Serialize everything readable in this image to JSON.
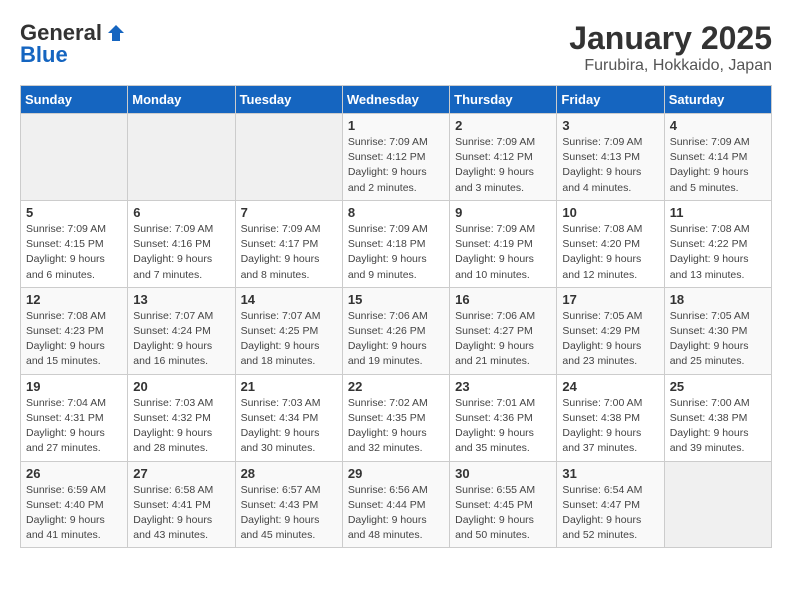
{
  "header": {
    "logo_line1": "General",
    "logo_line2": "Blue",
    "title": "January 2025",
    "subtitle": "Furubira, Hokkaido, Japan"
  },
  "calendar": {
    "days_of_week": [
      "Sunday",
      "Monday",
      "Tuesday",
      "Wednesday",
      "Thursday",
      "Friday",
      "Saturday"
    ],
    "weeks": [
      [
        {
          "day": "",
          "info": ""
        },
        {
          "day": "",
          "info": ""
        },
        {
          "day": "",
          "info": ""
        },
        {
          "day": "1",
          "info": "Sunrise: 7:09 AM\nSunset: 4:12 PM\nDaylight: 9 hours\nand 2 minutes."
        },
        {
          "day": "2",
          "info": "Sunrise: 7:09 AM\nSunset: 4:12 PM\nDaylight: 9 hours\nand 3 minutes."
        },
        {
          "day": "3",
          "info": "Sunrise: 7:09 AM\nSunset: 4:13 PM\nDaylight: 9 hours\nand 4 minutes."
        },
        {
          "day": "4",
          "info": "Sunrise: 7:09 AM\nSunset: 4:14 PM\nDaylight: 9 hours\nand 5 minutes."
        }
      ],
      [
        {
          "day": "5",
          "info": "Sunrise: 7:09 AM\nSunset: 4:15 PM\nDaylight: 9 hours\nand 6 minutes."
        },
        {
          "day": "6",
          "info": "Sunrise: 7:09 AM\nSunset: 4:16 PM\nDaylight: 9 hours\nand 7 minutes."
        },
        {
          "day": "7",
          "info": "Sunrise: 7:09 AM\nSunset: 4:17 PM\nDaylight: 9 hours\nand 8 minutes."
        },
        {
          "day": "8",
          "info": "Sunrise: 7:09 AM\nSunset: 4:18 PM\nDaylight: 9 hours\nand 9 minutes."
        },
        {
          "day": "9",
          "info": "Sunrise: 7:09 AM\nSunset: 4:19 PM\nDaylight: 9 hours\nand 10 minutes."
        },
        {
          "day": "10",
          "info": "Sunrise: 7:08 AM\nSunset: 4:20 PM\nDaylight: 9 hours\nand 12 minutes."
        },
        {
          "day": "11",
          "info": "Sunrise: 7:08 AM\nSunset: 4:22 PM\nDaylight: 9 hours\nand 13 minutes."
        }
      ],
      [
        {
          "day": "12",
          "info": "Sunrise: 7:08 AM\nSunset: 4:23 PM\nDaylight: 9 hours\nand 15 minutes."
        },
        {
          "day": "13",
          "info": "Sunrise: 7:07 AM\nSunset: 4:24 PM\nDaylight: 9 hours\nand 16 minutes."
        },
        {
          "day": "14",
          "info": "Sunrise: 7:07 AM\nSunset: 4:25 PM\nDaylight: 9 hours\nand 18 minutes."
        },
        {
          "day": "15",
          "info": "Sunrise: 7:06 AM\nSunset: 4:26 PM\nDaylight: 9 hours\nand 19 minutes."
        },
        {
          "day": "16",
          "info": "Sunrise: 7:06 AM\nSunset: 4:27 PM\nDaylight: 9 hours\nand 21 minutes."
        },
        {
          "day": "17",
          "info": "Sunrise: 7:05 AM\nSunset: 4:29 PM\nDaylight: 9 hours\nand 23 minutes."
        },
        {
          "day": "18",
          "info": "Sunrise: 7:05 AM\nSunset: 4:30 PM\nDaylight: 9 hours\nand 25 minutes."
        }
      ],
      [
        {
          "day": "19",
          "info": "Sunrise: 7:04 AM\nSunset: 4:31 PM\nDaylight: 9 hours\nand 27 minutes."
        },
        {
          "day": "20",
          "info": "Sunrise: 7:03 AM\nSunset: 4:32 PM\nDaylight: 9 hours\nand 28 minutes."
        },
        {
          "day": "21",
          "info": "Sunrise: 7:03 AM\nSunset: 4:34 PM\nDaylight: 9 hours\nand 30 minutes."
        },
        {
          "day": "22",
          "info": "Sunrise: 7:02 AM\nSunset: 4:35 PM\nDaylight: 9 hours\nand 32 minutes."
        },
        {
          "day": "23",
          "info": "Sunrise: 7:01 AM\nSunset: 4:36 PM\nDaylight: 9 hours\nand 35 minutes."
        },
        {
          "day": "24",
          "info": "Sunrise: 7:00 AM\nSunset: 4:38 PM\nDaylight: 9 hours\nand 37 minutes."
        },
        {
          "day": "25",
          "info": "Sunrise: 7:00 AM\nSunset: 4:38 PM\nDaylight: 9 hours\nand 39 minutes."
        }
      ],
      [
        {
          "day": "26",
          "info": "Sunrise: 6:59 AM\nSunset: 4:40 PM\nDaylight: 9 hours\nand 41 minutes."
        },
        {
          "day": "27",
          "info": "Sunrise: 6:58 AM\nSunset: 4:41 PM\nDaylight: 9 hours\nand 43 minutes."
        },
        {
          "day": "28",
          "info": "Sunrise: 6:57 AM\nSunset: 4:43 PM\nDaylight: 9 hours\nand 45 minutes."
        },
        {
          "day": "29",
          "info": "Sunrise: 6:56 AM\nSunset: 4:44 PM\nDaylight: 9 hours\nand 48 minutes."
        },
        {
          "day": "30",
          "info": "Sunrise: 6:55 AM\nSunset: 4:45 PM\nDaylight: 9 hours\nand 50 minutes."
        },
        {
          "day": "31",
          "info": "Sunrise: 6:54 AM\nSunset: 4:47 PM\nDaylight: 9 hours\nand 52 minutes."
        },
        {
          "day": "",
          "info": ""
        }
      ]
    ]
  }
}
